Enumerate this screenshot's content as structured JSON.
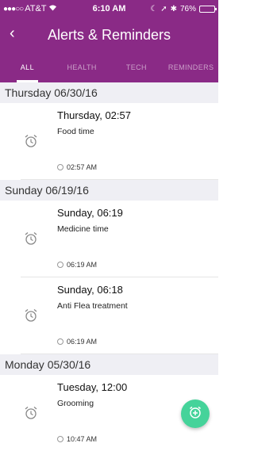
{
  "status_bar": {
    "carrier": "AT&T",
    "time": "6:10 AM",
    "battery": "76%",
    "battery_level": 0.76
  },
  "nav": {
    "back_icon": "chevron-left-icon",
    "title": "Alerts & Reminders"
  },
  "tabs": [
    {
      "label": "ALL",
      "active": true
    },
    {
      "label": "HEALTH",
      "active": false
    },
    {
      "label": "TECH",
      "active": false
    },
    {
      "label": "REMINDERS",
      "active": false
    }
  ],
  "sections": [
    {
      "header": "Thursday 06/30/16",
      "items": [
        {
          "title": "Thursday, 02:57",
          "description": "Food time",
          "time": "02:57 AM",
          "icon": "alarm-clock-icon"
        }
      ]
    },
    {
      "header": "Sunday 06/19/16",
      "items": [
        {
          "title": "Sunday, 06:19",
          "description": "Medicine time",
          "time": "06:19 AM",
          "icon": "alarm-clock-icon"
        },
        {
          "title": "Sunday, 06:18",
          "description": "Anti Flea treatment",
          "time": "06:19 AM",
          "icon": "alarm-clock-icon"
        }
      ]
    },
    {
      "header": "Monday 05/30/16",
      "items": [
        {
          "title": "Tuesday, 12:00",
          "description": "Grooming",
          "time": "10:47 AM",
          "icon": "alarm-clock-icon"
        }
      ]
    }
  ],
  "fab": {
    "icon": "add-alarm-icon",
    "color": "#45d39a"
  },
  "colors": {
    "header": "#8a2a86",
    "section_bg": "#efeff4"
  }
}
